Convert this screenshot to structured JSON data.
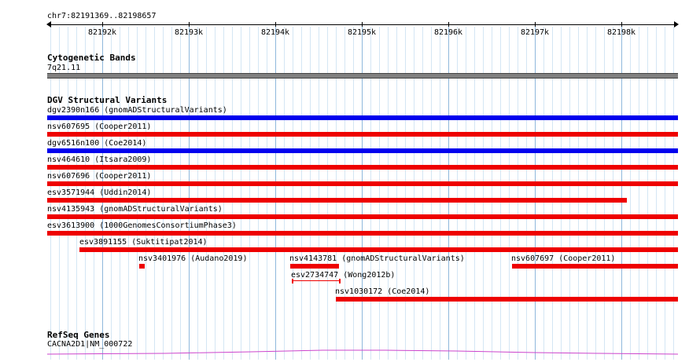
{
  "ruler": {
    "coordinate_text": "chr7:82191369..82198657",
    "ticks": [
      "82192k",
      "82193k",
      "82194k",
      "82195k",
      "82196k",
      "82197k",
      "82198k"
    ]
  },
  "cytoband": {
    "title": "Cytogenetic Bands",
    "band_label": "7q21.11",
    "color": "#808080"
  },
  "dgv": {
    "title": "DGV Structural Variants",
    "colors": {
      "gain": "#0000ee",
      "loss": "#ee0000"
    },
    "variants": [
      {
        "label": "dgv2390n166 (gnomADStructuralVariants)",
        "type": "gain"
      },
      {
        "label": "nsv607695 (Cooper2011)",
        "type": "loss"
      },
      {
        "label": "dgv6516n100 (Coe2014)",
        "type": "gain"
      },
      {
        "label": "nsv464610 (Itsara2009)",
        "type": "loss"
      },
      {
        "label": "nsv607696 (Cooper2011)",
        "type": "loss"
      },
      {
        "label": "esv3571944 (Uddin2014)",
        "type": "loss"
      },
      {
        "label": "nsv4135943 (gnomADStructuralVariants)",
        "type": "loss"
      },
      {
        "label": "esv3613900 (1000GenomesConsortiumPhase3)",
        "type": "loss"
      },
      {
        "label": "esv3891155 (Suktitipat2014)",
        "type": "loss"
      },
      {
        "label": "nsv3401976 (Audano2019)",
        "type": "loss"
      },
      {
        "label": "nsv4143781 (gnomADStructuralVariants)",
        "type": "loss"
      },
      {
        "label": "nsv607697 (Cooper2011)",
        "type": "loss"
      },
      {
        "label": "esv2734747 (Wong2012b)",
        "type": "loss"
      },
      {
        "label": "nsv1030172 (Coe2014)",
        "type": "loss"
      }
    ]
  },
  "refseq": {
    "title": "RefSeq Genes",
    "gene_label": "CACNA2D1|NM_000722",
    "color": "#cc44cc"
  }
}
